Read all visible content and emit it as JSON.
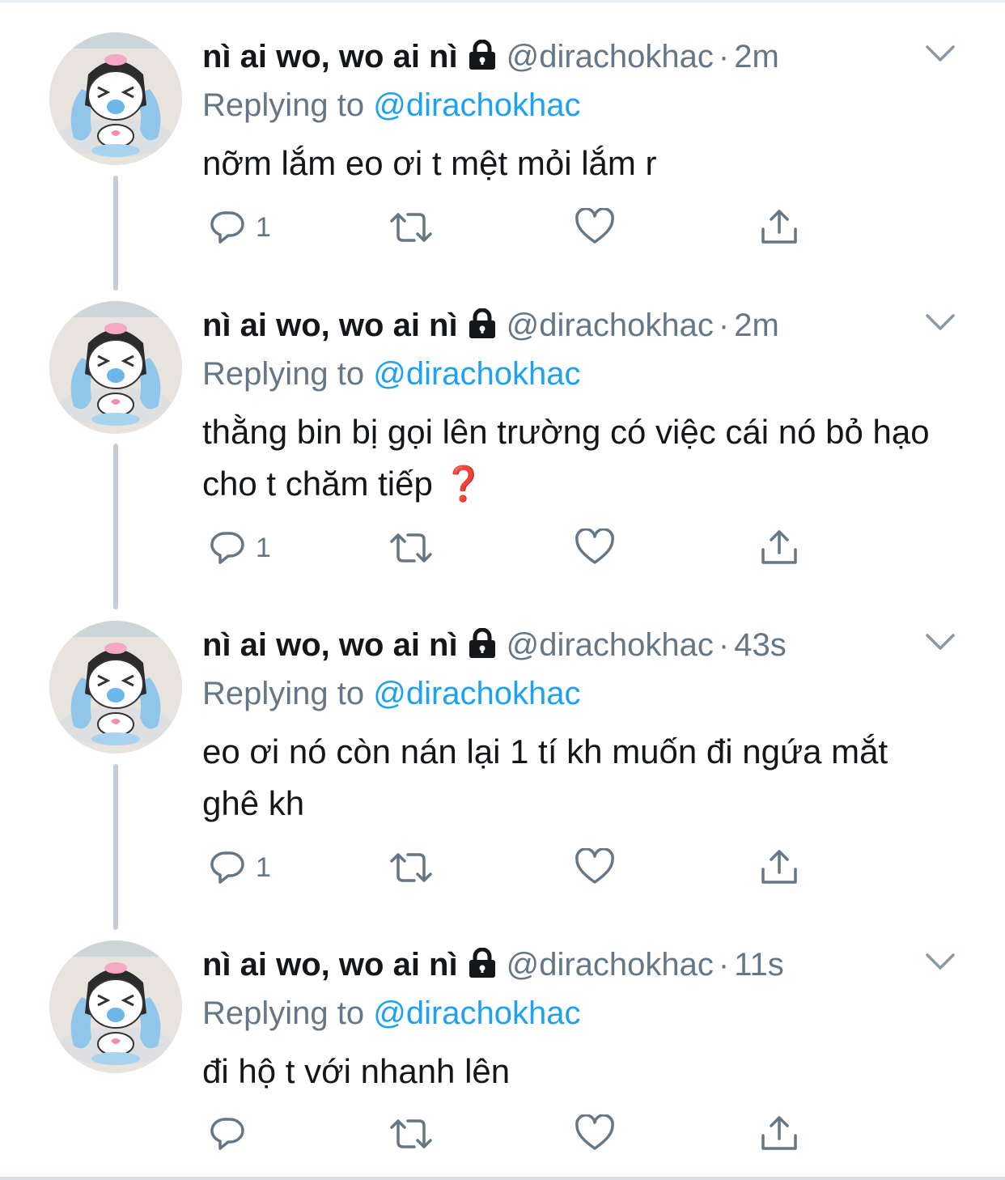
{
  "colors": {
    "name": "#14171a",
    "meta": "#657786",
    "mention": "#1da1f2",
    "thread_line": "#c5ced6"
  },
  "icons": {
    "reply": "reply-icon",
    "retweet": "retweet-icon",
    "like": "heart-icon",
    "share": "share-icon",
    "more": "chevron-down-icon",
    "lock": "lock-icon"
  },
  "tweets": [
    {
      "name": "nì ai wo, wo ai nì",
      "handle": "@dirachokhac",
      "dot": "·",
      "time": "2m",
      "reply_prefix": "Replying to ",
      "reply_to": "@dirachokhac",
      "text": "nỡm lắm eo ơi t mệt mỏi lắm r",
      "reply_count": "1"
    },
    {
      "name": "nì ai wo, wo ai nì",
      "handle": "@dirachokhac",
      "dot": "·",
      "time": "2m",
      "reply_prefix": "Replying to ",
      "reply_to": "@dirachokhac",
      "text": "thằng bin bị gọi lên trường có việc cái nó bỏ hạo cho t chăm tiếp  ❓",
      "reply_count": "1"
    },
    {
      "name": "nì ai wo, wo ai nì",
      "handle": "@dirachokhac",
      "dot": "·",
      "time": "43s",
      "reply_prefix": "Replying to ",
      "reply_to": "@dirachokhac",
      "text": "eo ơi nó còn nán lại 1 tí kh muốn đi ngứa mắt ghê kh",
      "reply_count": "1"
    },
    {
      "name": "nì ai wo, wo ai nì",
      "handle": "@dirachokhac",
      "dot": "·",
      "time": "11s",
      "reply_prefix": "Replying to ",
      "reply_to": "@dirachokhac",
      "text": "đi hộ t với nhanh lên",
      "reply_count": ""
    }
  ]
}
